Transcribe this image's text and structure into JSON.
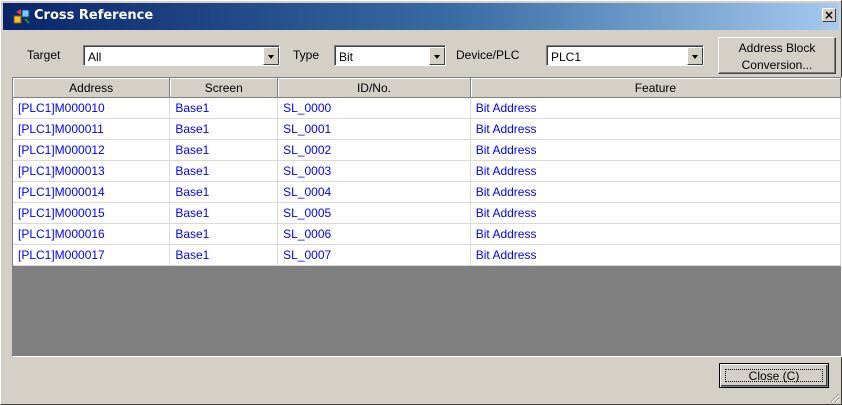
{
  "window": {
    "title": "Cross Reference",
    "close_glyph": "×"
  },
  "filters": {
    "target": {
      "label": "Target",
      "value": "All"
    },
    "type": {
      "label": "Type",
      "value": "Bit"
    },
    "device": {
      "label": "Device/PLC",
      "value": "PLC1"
    }
  },
  "buttons": {
    "address_block_line1": "Address Block",
    "address_block_line2": "Conversion...",
    "close": "Close (C)"
  },
  "table": {
    "columns": [
      "Address",
      "Screen",
      "ID/No.",
      "Feature"
    ],
    "rows": [
      [
        "[PLC1]M000010",
        "Base1",
        "SL_0000",
        "Bit Address"
      ],
      [
        "[PLC1]M000011",
        "Base1",
        "SL_0001",
        "Bit Address"
      ],
      [
        "[PLC1]M000012",
        "Base1",
        "SL_0002",
        "Bit Address"
      ],
      [
        "[PLC1]M000013",
        "Base1",
        "SL_0003",
        "Bit Address"
      ],
      [
        "[PLC1]M000014",
        "Base1",
        "SL_0004",
        "Bit Address"
      ],
      [
        "[PLC1]M000015",
        "Base1",
        "SL_0005",
        "Bit Address"
      ],
      [
        "[PLC1]M000016",
        "Base1",
        "SL_0006",
        "Bit Address"
      ],
      [
        "[PLC1]M000017",
        "Base1",
        "SL_0007",
        "Bit Address"
      ]
    ]
  },
  "colors": {
    "title_gradient_start": "#0a246a",
    "title_gradient_end": "#a6caf0",
    "cell_text": "#0000ff",
    "dialog_face": "#d4d0c8",
    "grid_empty": "#808080"
  },
  "icons": {
    "title": "cross-reference-app-icon",
    "dropdown": "chevron-down-icon",
    "grip": "resize-grip-icon"
  }
}
